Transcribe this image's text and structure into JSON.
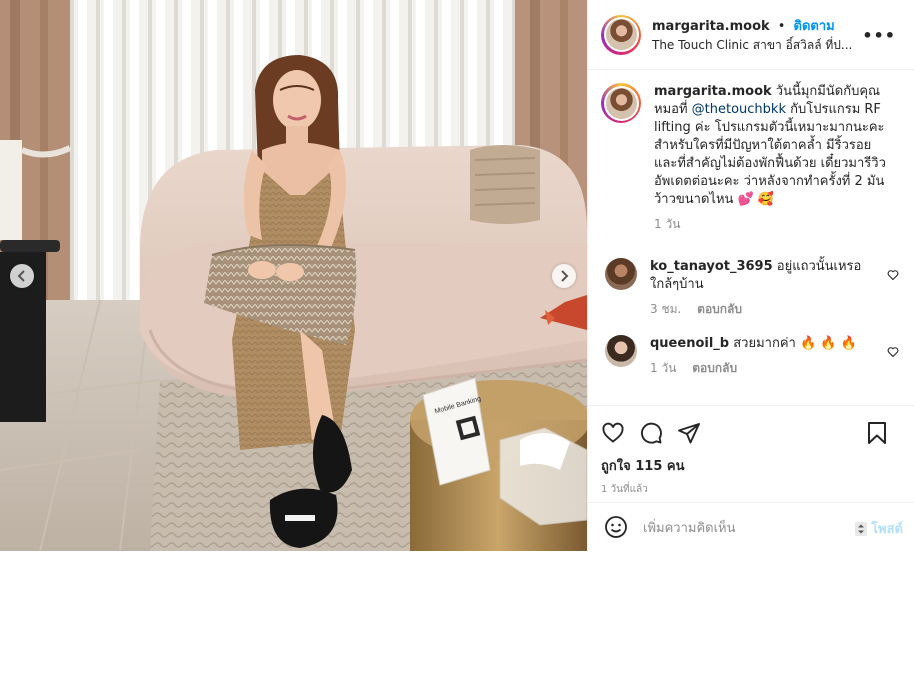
{
  "header": {
    "username": "margarita.mook",
    "separator": "•",
    "follow_label": "ติดตาม",
    "location": "The Touch Clinic สาขา อิ์สวิลล์ ที่ป...",
    "more_label": "•••"
  },
  "caption": {
    "username": "margarita.mook",
    "text_before": " วันนี้มุกมีนัดกับคุณหมอที่ ",
    "mention": "@thetouchbkk",
    "text_after": " กับโปรแกรม RF lifting ค่ะ โปรแกรมตัวนี้เหมาะมากนะคะ สำหรับใครที่มีปัญหาใต้ตาคล้ำ มีริ้วรอย และที่สำคัญไม่ต้องพักฟื้นด้วย เดี๋ยวมารีวิวอัพเดตต่อนะคะ ว่าหลังจากทำครั้งที่ 2 มันว้าวขนาดไหน ",
    "emoji_heart": "💕",
    "emoji_face": "🥰",
    "time": "1 วัน"
  },
  "comments": [
    {
      "username": "ko_tanayot_3695",
      "text": " อยู่แถวนั้นเหรอ ใกล้ๆบ้าน",
      "time": "3 ชม.",
      "reply_label": "ตอบกลับ"
    },
    {
      "username": "queenoil_b",
      "text": " สวยมากค่า ",
      "emoji": "🔥 🔥 🔥",
      "time": "1 วัน",
      "reply_label": "ตอบกลับ"
    }
  ],
  "actions": {
    "likes": "ถูกใจ 115 คน",
    "posted_ago": "1 วันที่แล้ว"
  },
  "add_comment": {
    "placeholder": "เพิ่มความคิดเห็น",
    "post_label": "โพสต์"
  },
  "photo": {
    "sign_title": "Mobile Banking"
  },
  "colors": {
    "accent": "#0095f6",
    "post_disabled": "#b2dffc",
    "muted": "#8e8e8e"
  }
}
